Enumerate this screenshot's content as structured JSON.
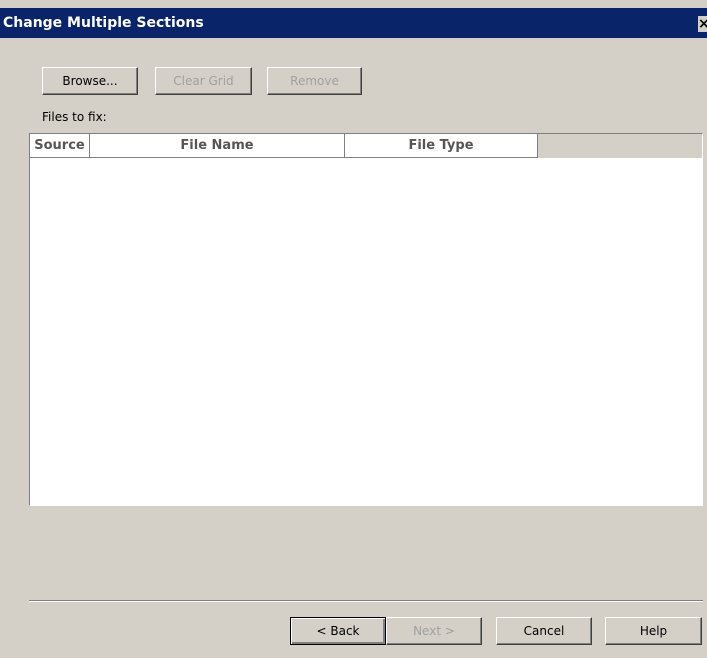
{
  "window": {
    "title": "Change Multiple Sections",
    "close_glyph": "×"
  },
  "toolbar": {
    "browse_label": "Browse...",
    "clear_grid_label": "Clear Grid",
    "remove_label": "Remove"
  },
  "files_label": "Files to fix:",
  "grid": {
    "columns": [
      "Source",
      "File Name",
      "File Type"
    ],
    "rows": []
  },
  "footer": {
    "back_label": "< Back",
    "next_label": "Next >",
    "cancel_label": "Cancel",
    "help_label": "Help"
  }
}
